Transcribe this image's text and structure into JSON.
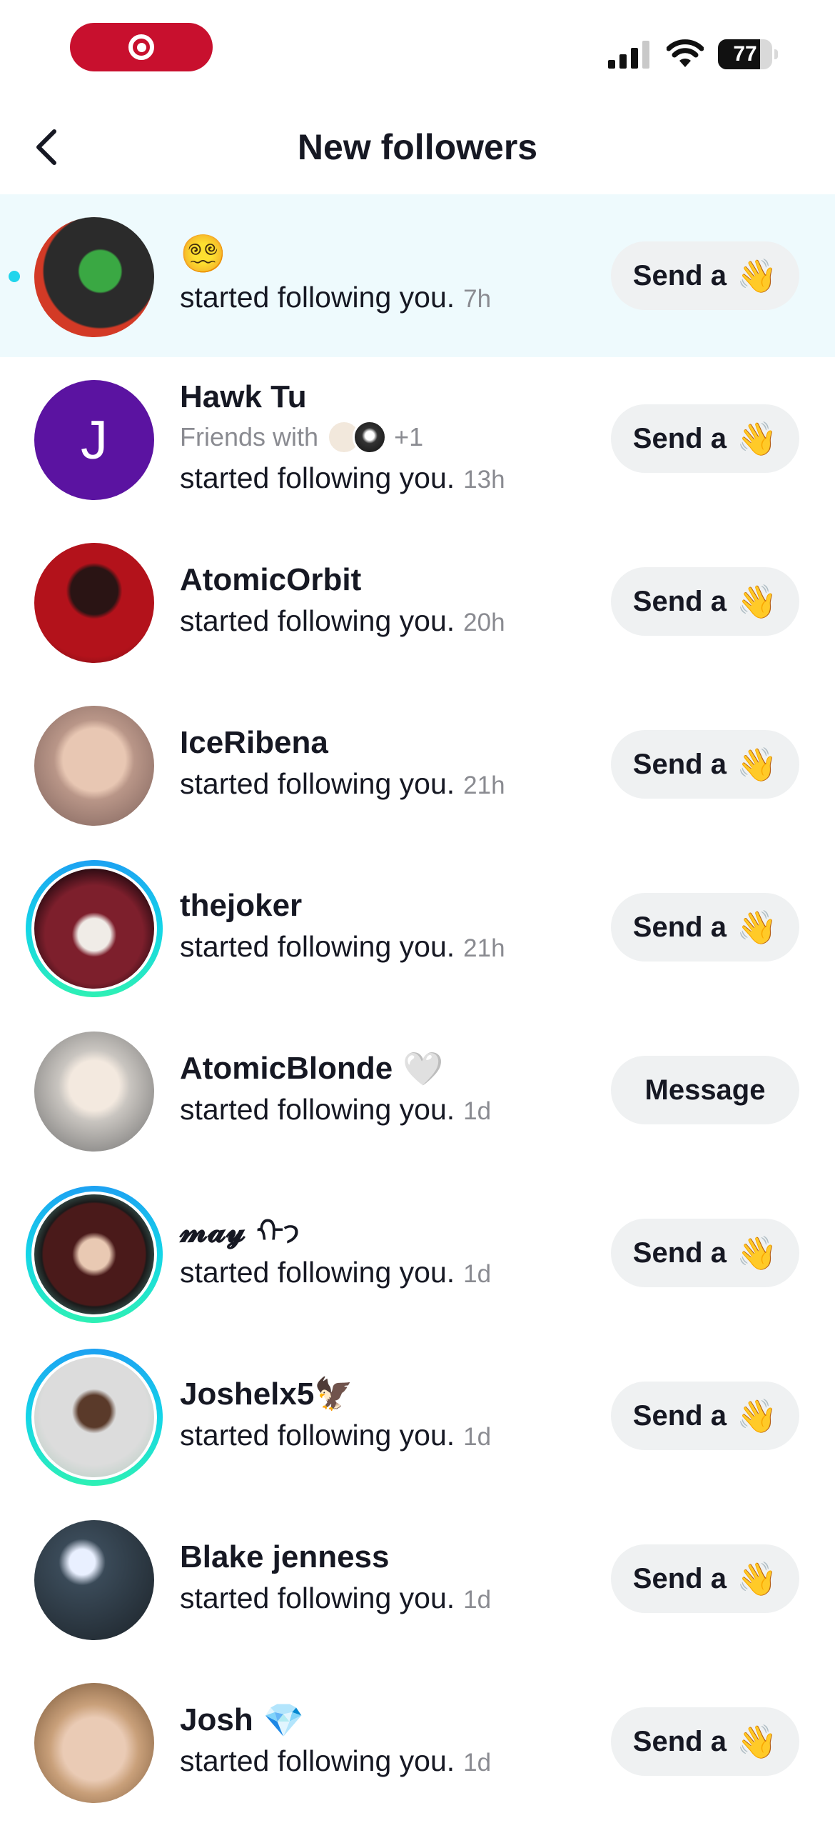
{
  "status_bar": {
    "battery_level": "77",
    "battery_fraction": 0.77,
    "recording_icon": "screen-recording-icon",
    "signal_icon": "cellular-signal-icon",
    "wifi_icon": "wifi-icon"
  },
  "header": {
    "title": "New followers",
    "back_icon": "chevron-left-icon"
  },
  "colors": {
    "accent_dot": "#20d5ec",
    "recording": "#c8102e",
    "unread_background": "#eefafd",
    "button_background": "#eff1f2",
    "story_ring": "#14d6e8"
  },
  "followers": [
    {
      "name": "😵‍💫",
      "action": "started following you.",
      "time": "7h",
      "button": "Send a",
      "button_emoji": "👋",
      "unread": true
    },
    {
      "name": "Hawk Tu",
      "avatar_letter": "J",
      "friends_prefix": "Friends with",
      "friends_more": "+1",
      "action": "started following you.",
      "time": "13h",
      "button": "Send a",
      "button_emoji": "👋"
    },
    {
      "name": "AtomicOrbit",
      "action": "started following you.",
      "time": "20h",
      "button": "Send a",
      "button_emoji": "👋"
    },
    {
      "name": "IceRibena",
      "action": "started following you.",
      "time": "21h",
      "button": "Send a",
      "button_emoji": "👋"
    },
    {
      "name": "thejoker",
      "action": "started following you.",
      "time": "21h",
      "button": "Send a",
      "button_emoji": "👋",
      "story_ring": true
    },
    {
      "name": "AtomicBlonde",
      "name_badge": "🤍",
      "action": "started following you.",
      "time": "1d",
      "button": "Message"
    },
    {
      "name": "𝓶𝓪𝔂",
      "name_badge": "ᡣ𐭩",
      "action": "started following you.",
      "time": "1d",
      "button": "Send a",
      "button_emoji": "👋",
      "story_ring": true
    },
    {
      "name": "Joshelx5🦅",
      "action": "started following you.",
      "time": "1d",
      "button": "Send a",
      "button_emoji": "👋",
      "story_ring": true
    },
    {
      "name": "Blake jenness",
      "action": "started following you.",
      "time": "1d",
      "button": "Send a",
      "button_emoji": "👋"
    },
    {
      "name": "Josh",
      "name_badge": "💎",
      "action": "started following you.",
      "time": "1d",
      "button": "Send a",
      "button_emoji": "👋"
    }
  ]
}
